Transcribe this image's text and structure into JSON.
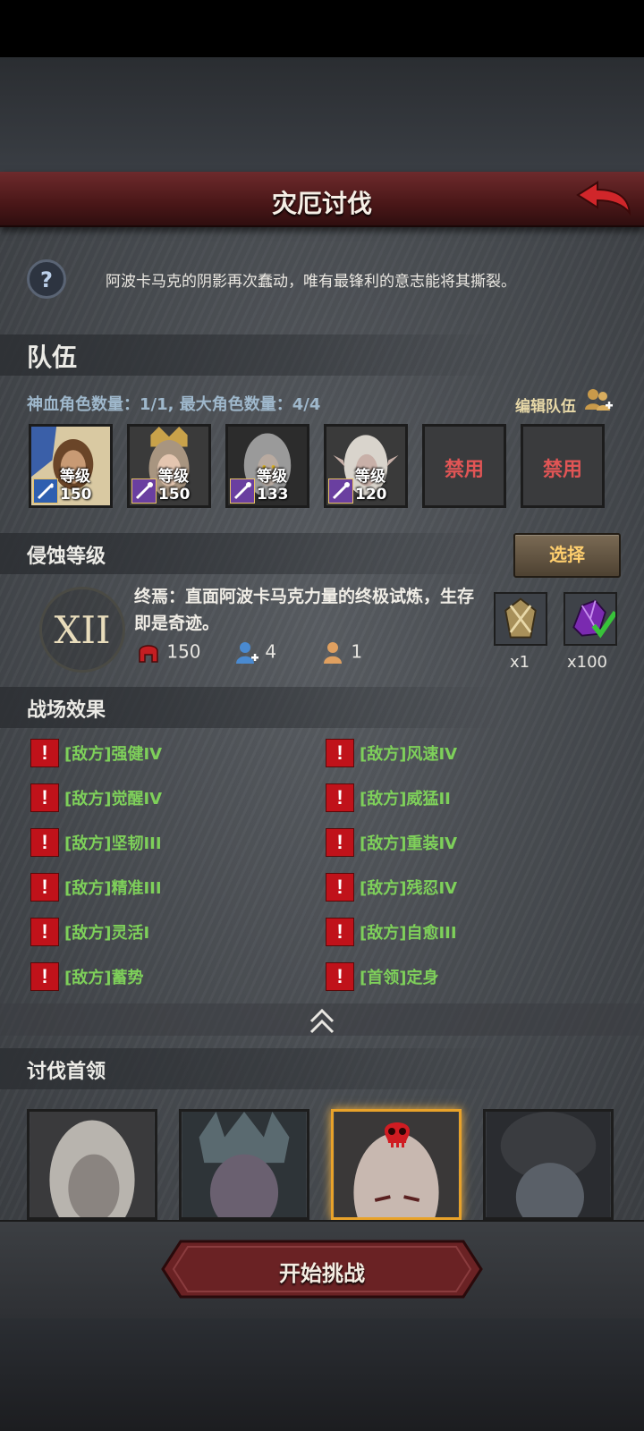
{
  "title": "灾厄讨伐",
  "description": "阿波卡马克的阴影再次蠢动，唯有最锋利的意志能将其撕裂。",
  "team": {
    "header": "队伍",
    "count_text": "神血角色数量：1/1, 最大角色数量：4/4",
    "edit_label": "编辑队伍",
    "slots": [
      {
        "level": "等级150"
      },
      {
        "level": "等级150"
      },
      {
        "level": "等级133"
      },
      {
        "level": "等级120"
      }
    ],
    "disabled_label": "禁用"
  },
  "corrosion": {
    "header": "侵蚀等级",
    "select_label": "选择",
    "level_roman": "XII",
    "desc": "终焉：直面阿波卡马克力量的终极试炼，生存即是奇迹。",
    "stats": {
      "helmet": "150",
      "team": "4",
      "single": "1"
    },
    "rewards": [
      {
        "count": "x1"
      },
      {
        "count": "x100"
      }
    ]
  },
  "battlefield": {
    "header": "战场效果",
    "effects_left": [
      "[敌方]强健IV",
      "[敌方]觉醒IV",
      "[敌方]坚韧III",
      "[敌方]精准III",
      "[敌方]灵活I",
      "[敌方]蓄势"
    ],
    "effects_right": [
      "[敌方]风速IV",
      "[敌方]威猛II",
      "[敌方]重装IV",
      "[敌方]残忍IV",
      "[敌方]自愈III",
      "[首领]定身"
    ]
  },
  "bosses": {
    "header": "讨伐首领"
  },
  "start_button": "开始挑战"
}
